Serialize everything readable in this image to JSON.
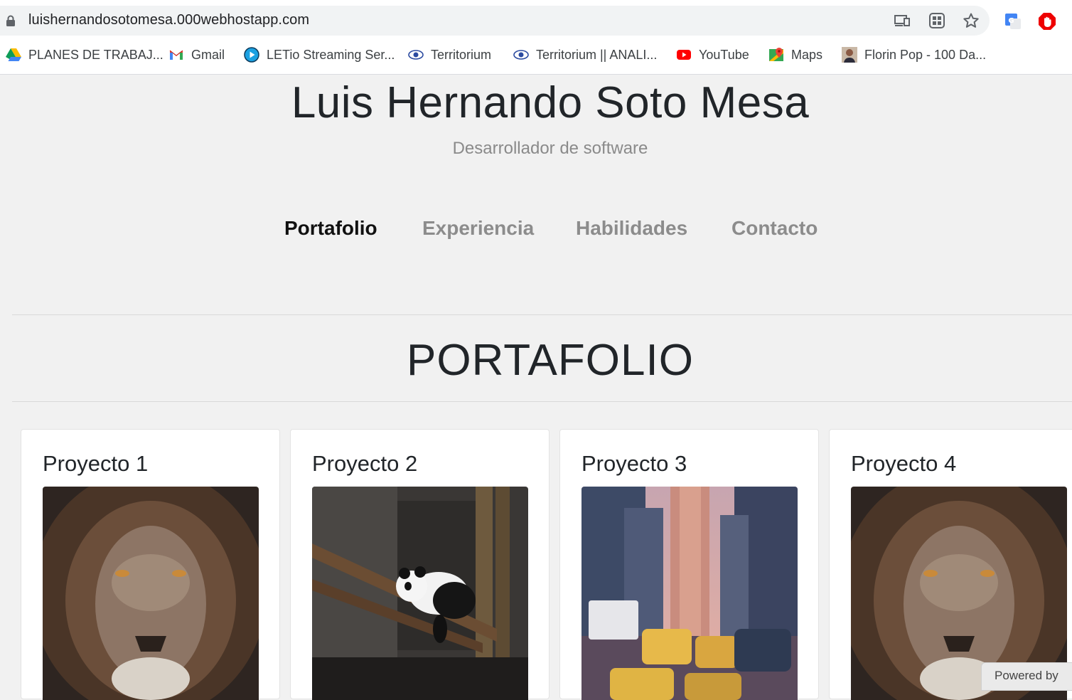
{
  "browser": {
    "url": "luishernandosotomesa.000webhostapp.com",
    "bookmarks": [
      {
        "label": "PLANES DE TRABAJ...",
        "icon": "google-drive-icon"
      },
      {
        "label": "Gmail",
        "icon": "gmail-icon"
      },
      {
        "label": "LETio Streaming Ser...",
        "icon": "play-circle-icon"
      },
      {
        "label": "Territorium",
        "icon": "territorium-eye-icon"
      },
      {
        "label": "Territorium || ANALI...",
        "icon": "territorium-eye-icon"
      },
      {
        "label": "YouTube",
        "icon": "youtube-icon"
      },
      {
        "label": "Maps",
        "icon": "google-maps-icon"
      },
      {
        "label": "Florin Pop - 100 Da...",
        "icon": "avatar-icon"
      }
    ],
    "toolbar_icons": [
      "cast-icon",
      "apps-grid-icon",
      "star-icon",
      "google-translate-icon",
      "adblock-icon"
    ]
  },
  "site": {
    "title": "Luis Hernando Soto Mesa",
    "subtitle": "Desarrollador de software",
    "nav": [
      {
        "label": "Portafolio",
        "active": true
      },
      {
        "label": "Experiencia",
        "active": false
      },
      {
        "label": "Habilidades",
        "active": false
      },
      {
        "label": "Contacto",
        "active": false
      }
    ],
    "section_title": "PORTAFOLIO",
    "projects": [
      {
        "title": "Proyecto 1",
        "image": "lion"
      },
      {
        "title": "Proyecto 2",
        "image": "panda"
      },
      {
        "title": "Proyecto 3",
        "image": "city-street"
      },
      {
        "title": "Proyecto 4",
        "image": "lion"
      }
    ],
    "badge": "Powered by"
  },
  "colors": {
    "page_bg": "#f1f1f1",
    "text_dark": "#212529",
    "nav_inactive": "#8c8c8c",
    "nav_active": "#111111"
  }
}
